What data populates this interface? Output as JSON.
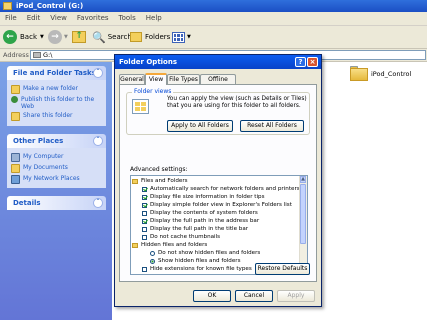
{
  "window": {
    "title": "iPod_Control (G:)"
  },
  "menu": [
    "File",
    "Edit",
    "View",
    "Favorites",
    "Tools",
    "Help"
  ],
  "toolbar": {
    "back": "Back",
    "search": "Search",
    "folders": "Folders"
  },
  "address": {
    "label": "Address",
    "value": "G:\\"
  },
  "tasks": {
    "title": "File and Folder Tasks",
    "items": [
      "Make a new folder",
      "Publish this folder to the Web",
      "Share this folder"
    ]
  },
  "places": {
    "title": "Other Places",
    "items": [
      "My Computer",
      "My Documents",
      "My Network Places"
    ]
  },
  "details": {
    "title": "Details"
  },
  "folder_item": {
    "name": "iPod_Control"
  },
  "dialog": {
    "title": "Folder Options",
    "tabs": [
      "General",
      "View",
      "File Types",
      "Offline Files"
    ],
    "active_tab": "View",
    "folder_views": {
      "label": "Folder views",
      "description": "You can apply the view (such as Details or Tiles) that you are using for this folder to all folders.",
      "apply_all": "Apply to All Folders",
      "reset_all": "Reset All Folders"
    },
    "advanced_label": "Advanced settings:",
    "settings": [
      {
        "type": "folder",
        "text": "Files and Folders"
      },
      {
        "type": "check",
        "checked": true,
        "text": "Automatically search for network folders and printers"
      },
      {
        "type": "check",
        "checked": true,
        "text": "Display file size information in folder tips"
      },
      {
        "type": "check",
        "checked": true,
        "text": "Display simple folder view in Explorer's Folders list"
      },
      {
        "type": "check",
        "checked": false,
        "text": "Display the contents of system folders"
      },
      {
        "type": "check",
        "checked": true,
        "text": "Display the full path in the address bar"
      },
      {
        "type": "check",
        "checked": false,
        "text": "Display the full path in the title bar"
      },
      {
        "type": "check",
        "checked": false,
        "text": "Do not cache thumbnails"
      },
      {
        "type": "folder",
        "text": "Hidden files and folders"
      },
      {
        "type": "radio",
        "checked": false,
        "text": "Do not show hidden files and folders"
      },
      {
        "type": "radio",
        "checked": true,
        "text": "Show hidden files and folders"
      },
      {
        "type": "check",
        "checked": false,
        "text": "Hide extensions for known file types"
      }
    ],
    "restore_defaults": "Restore Defaults",
    "ok": "OK",
    "cancel": "Cancel",
    "apply": "Apply"
  },
  "colors": {
    "xp_blue": "#0a5cf0",
    "task_pane": "#6375d6",
    "dialog_bg": "#ece9d8",
    "tab_highlight": "#f5a83a"
  }
}
